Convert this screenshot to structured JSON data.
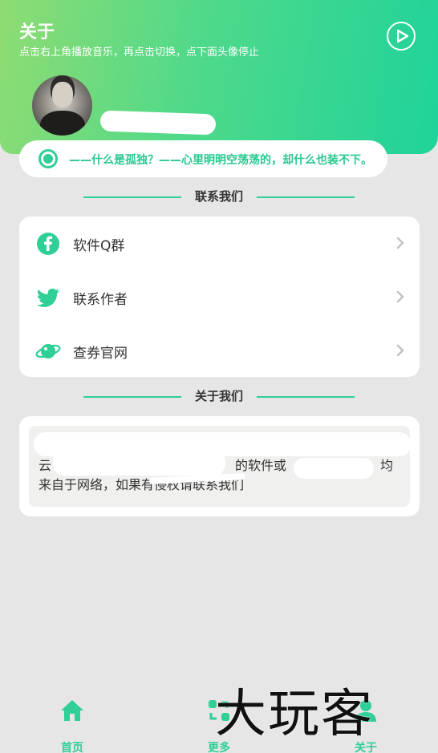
{
  "header": {
    "title": "关于",
    "subtitle": "点击右上角播放音乐，再点击切换，点下面头像停止",
    "play_icon": "play-circle-icon"
  },
  "quote": {
    "text": "——什么是孤独？——心里明明空荡荡的，却什么也装不下。"
  },
  "contact_section": {
    "title": "联系我们",
    "items": [
      {
        "label": "软件Q群",
        "icon": "facebook-icon",
        "color": "#2fcf96"
      },
      {
        "label": "联系作者",
        "icon": "twitter-icon",
        "color": "#2fcf96"
      },
      {
        "label": "查券官网",
        "icon": "planet-icon",
        "color": "#2fcf96"
      }
    ]
  },
  "about_section": {
    "title": "关于我们",
    "line1_visible": "云",
    "line1_mid": "的软件或",
    "line1_end": "均",
    "line2": "来自于网络，如果有侵权请联系我们"
  },
  "tabbar": {
    "tabs": [
      {
        "label": "首页",
        "icon": "home-icon"
      },
      {
        "label": "更多",
        "icon": "more-icon"
      },
      {
        "label": "关于",
        "icon": "user-icon"
      }
    ]
  },
  "watermark": {
    "text": "大玩客"
  },
  "colors": {
    "accent": "#2fcf96",
    "background": "#e6e6e6"
  }
}
